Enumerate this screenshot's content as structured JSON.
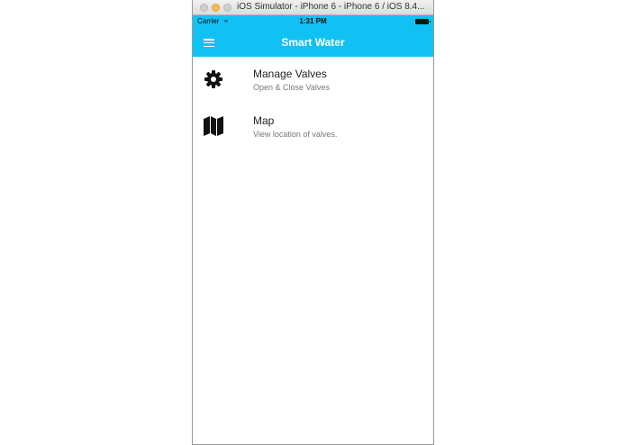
{
  "window": {
    "title": "iOS Simulator - iPhone 6 - iPhone 6 / iOS 8.4..."
  },
  "status_bar": {
    "carrier": "Carrier",
    "wifi_icon": "wifi-icon",
    "time": "1:31 PM",
    "battery_icon": "battery-icon"
  },
  "nav": {
    "title": "Smart Water",
    "menu_icon": "hamburger-menu-icon"
  },
  "colors": {
    "nav_background": "#11c1f3",
    "nav_text": "#ffffff"
  },
  "menu": [
    {
      "icon": "gear-icon",
      "title": "Manage Valves",
      "subtitle": "Open & Close Valves"
    },
    {
      "icon": "map-icon",
      "title": "Map",
      "subtitle": "View location of valves."
    }
  ]
}
